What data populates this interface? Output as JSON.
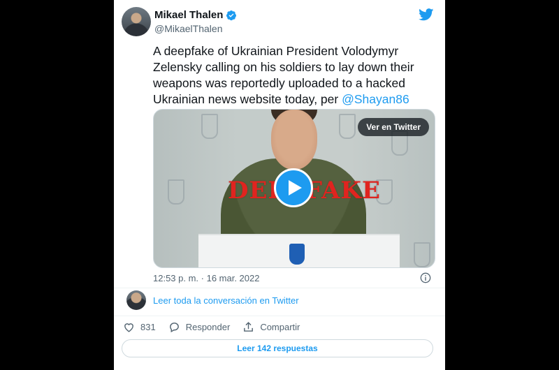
{
  "author": {
    "name": "Mikael Thalen",
    "handle": "@MikaelThalen"
  },
  "tweet": {
    "text": "A deepfake of Ukrainian President Volodymyr Zelensky calling on his soldiers to lay down their weapons was reportedly uploaded to a hacked Ukrainian news website today, per ",
    "mention": "@Shayan86"
  },
  "media": {
    "view_on_twitter": "Ver en Twitter",
    "overlay_word": "DEEPFAKE"
  },
  "timestamp": "12:53 p. m. · 16 mar. 2022",
  "read_conversation": "Leer toda la conversación en Twitter",
  "actions": {
    "likes": "831",
    "reply_label": "Responder",
    "share_label": "Compartir"
  },
  "read_replies": "Leer 142 respuestas",
  "colors": {
    "accent": "#1d9bf0",
    "text": "#0f1419",
    "muted": "#536471"
  }
}
